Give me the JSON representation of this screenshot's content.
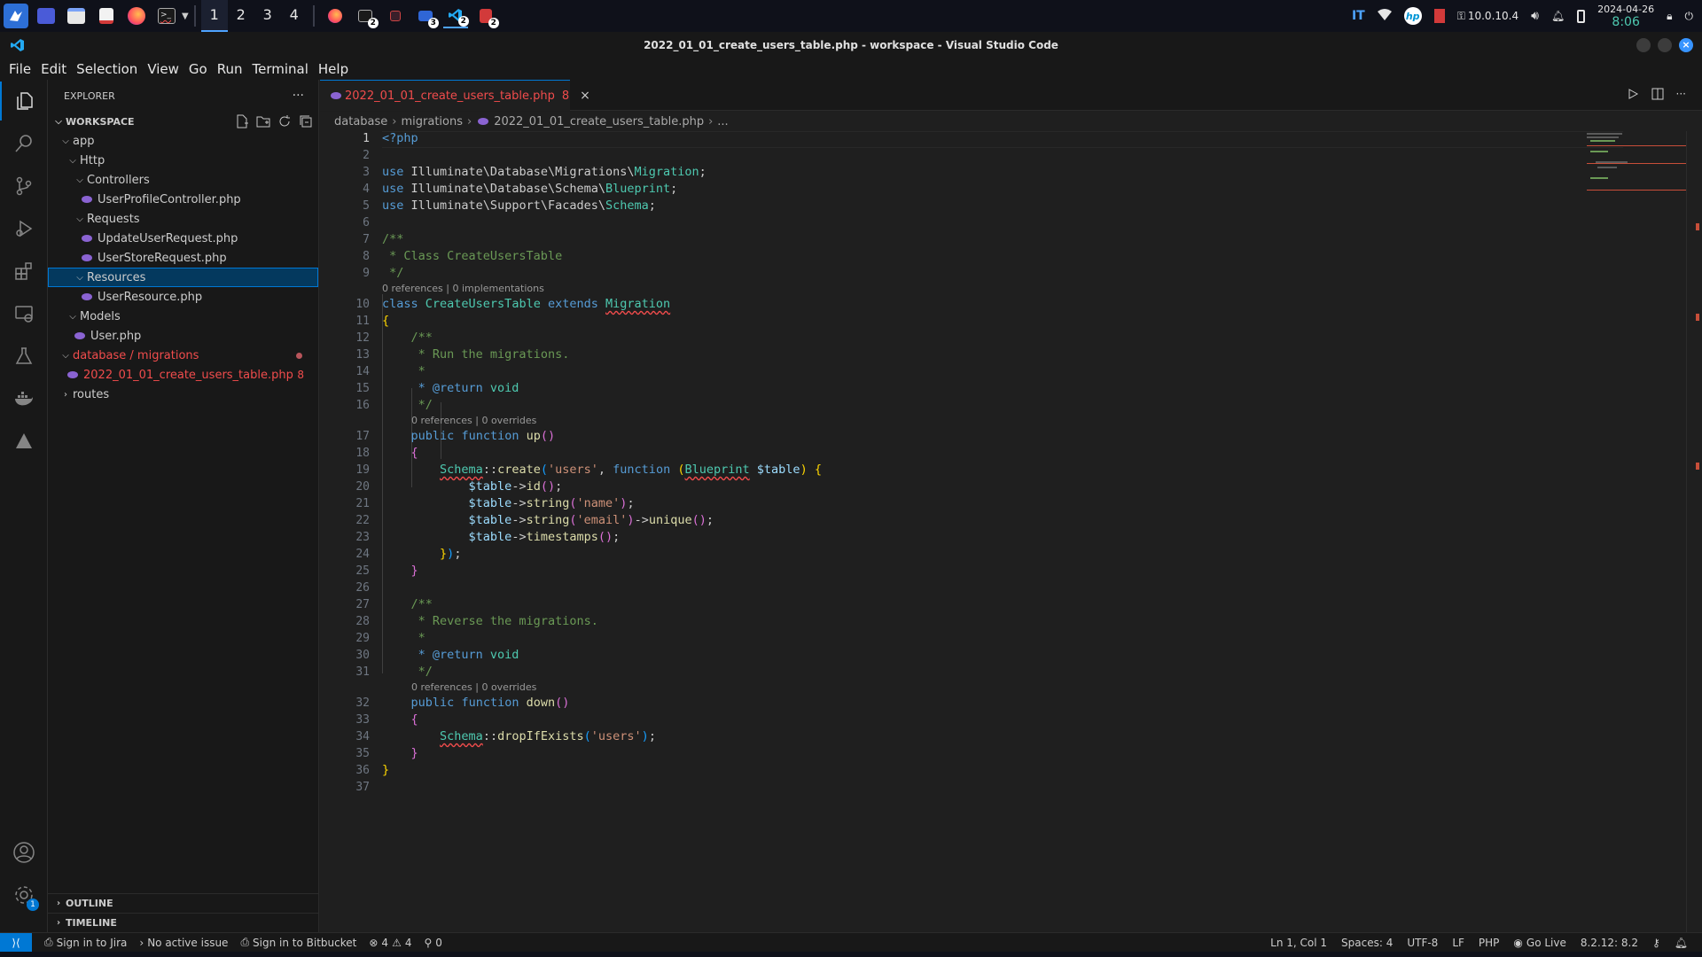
{
  "taskbar": {
    "workspaces": [
      "1",
      "2",
      "3",
      "4"
    ],
    "badges": {
      "files": "3",
      "vscode": "2",
      "terminal": "2",
      "pdf": "2"
    },
    "layout": "IT",
    "ip": "10.0.10.4",
    "date": "2024-04-26",
    "time": "8:06"
  },
  "window": {
    "title": "2022_01_01_create_users_table.php - workspace - Visual Studio Code"
  },
  "menu": [
    "File",
    "Edit",
    "Selection",
    "View",
    "Go",
    "Run",
    "Terminal",
    "Help"
  ],
  "sidebar": {
    "title": "EXPLORER",
    "more": "···",
    "workspace": "WORKSPACE",
    "tree": [
      {
        "label": "app",
        "kind": "folder"
      },
      {
        "label": "Http",
        "kind": "folder"
      },
      {
        "label": "Controllers",
        "kind": "folder"
      },
      {
        "label": "UserProfileController.php",
        "kind": "php"
      },
      {
        "label": "Requests",
        "kind": "folder"
      },
      {
        "label": "UpdateUserRequest.php",
        "kind": "php"
      },
      {
        "label": "UserStoreRequest.php",
        "kind": "php"
      },
      {
        "label": "Resources",
        "kind": "folder"
      },
      {
        "label": "UserResource.php",
        "kind": "php"
      },
      {
        "label": "Models",
        "kind": "folder"
      },
      {
        "label": "User.php",
        "kind": "php"
      },
      {
        "label": "database / migrations",
        "kind": "folder"
      },
      {
        "label": "2022_01_01_create_users_table.php",
        "kind": "php",
        "badge": "8"
      },
      {
        "label": "routes",
        "kind": "folder"
      }
    ],
    "outline": "OUTLINE",
    "timeline": "TIMELINE",
    "settings_badge": "1"
  },
  "editor": {
    "tab": {
      "label": "2022_01_01_create_users_table.php",
      "problems": "8",
      "close": "×"
    },
    "breadcrumb": [
      "database",
      "migrations",
      "2022_01_01_create_users_table.php",
      "..."
    ],
    "lines": [
      "1",
      "2",
      "3",
      "4",
      "5",
      "6",
      "7",
      "8",
      "9",
      "10",
      "11",
      "12",
      "13",
      "14",
      "15",
      "16",
      "17",
      "18",
      "19",
      "20",
      "21",
      "22",
      "23",
      "24",
      "25",
      "26",
      "27",
      "28",
      "29",
      "30",
      "31",
      "32",
      "33",
      "34",
      "35",
      "36",
      "37"
    ],
    "code": {
      "php_open": "<?php",
      "use_migration_ns": "Illuminate\\Database\\Migrations\\",
      "use_migration_cls": "Migration",
      "use_blueprint_ns": "Illuminate\\Database\\Schema\\",
      "use_blueprint_cls": "Blueprint",
      "use_schema_ns": "Illuminate\\Support\\Facades\\",
      "use_schema_cls": "Schema",
      "doc_open": "/**",
      "doc_class": " * Class CreateUsersTable",
      "doc_close": " */",
      "lens_class": "0 references | 0 implementations",
      "class_name": "CreateUsersTable",
      "parent_class": "Migration",
      "doc_run": " * Run the migrations.",
      "doc_star": " *",
      "doc_return_tag": " * @return",
      "doc_return_type": " void",
      "lens_up": "0 references | 0 overrides",
      "fn_up": "up",
      "table_name": "'users'",
      "col_name": "'name'",
      "col_email": "'email'",
      "doc_reverse": " * Reverse the migrations.",
      "lens_down": "0 references | 0 overrides",
      "fn_down": "down"
    }
  },
  "statusbar": {
    "jira": "Sign in to Jira",
    "issue": "No active issue",
    "bitbucket": "Sign in to Bitbucket",
    "errors": "4",
    "warnings": "4",
    "ports": "0",
    "position": "Ln 1, Col 1",
    "spaces": "Spaces: 4",
    "encoding": "UTF-8",
    "eol": "LF",
    "language": "PHP",
    "golive": "Go Live",
    "php_version": "8.2.12: 8.2"
  }
}
